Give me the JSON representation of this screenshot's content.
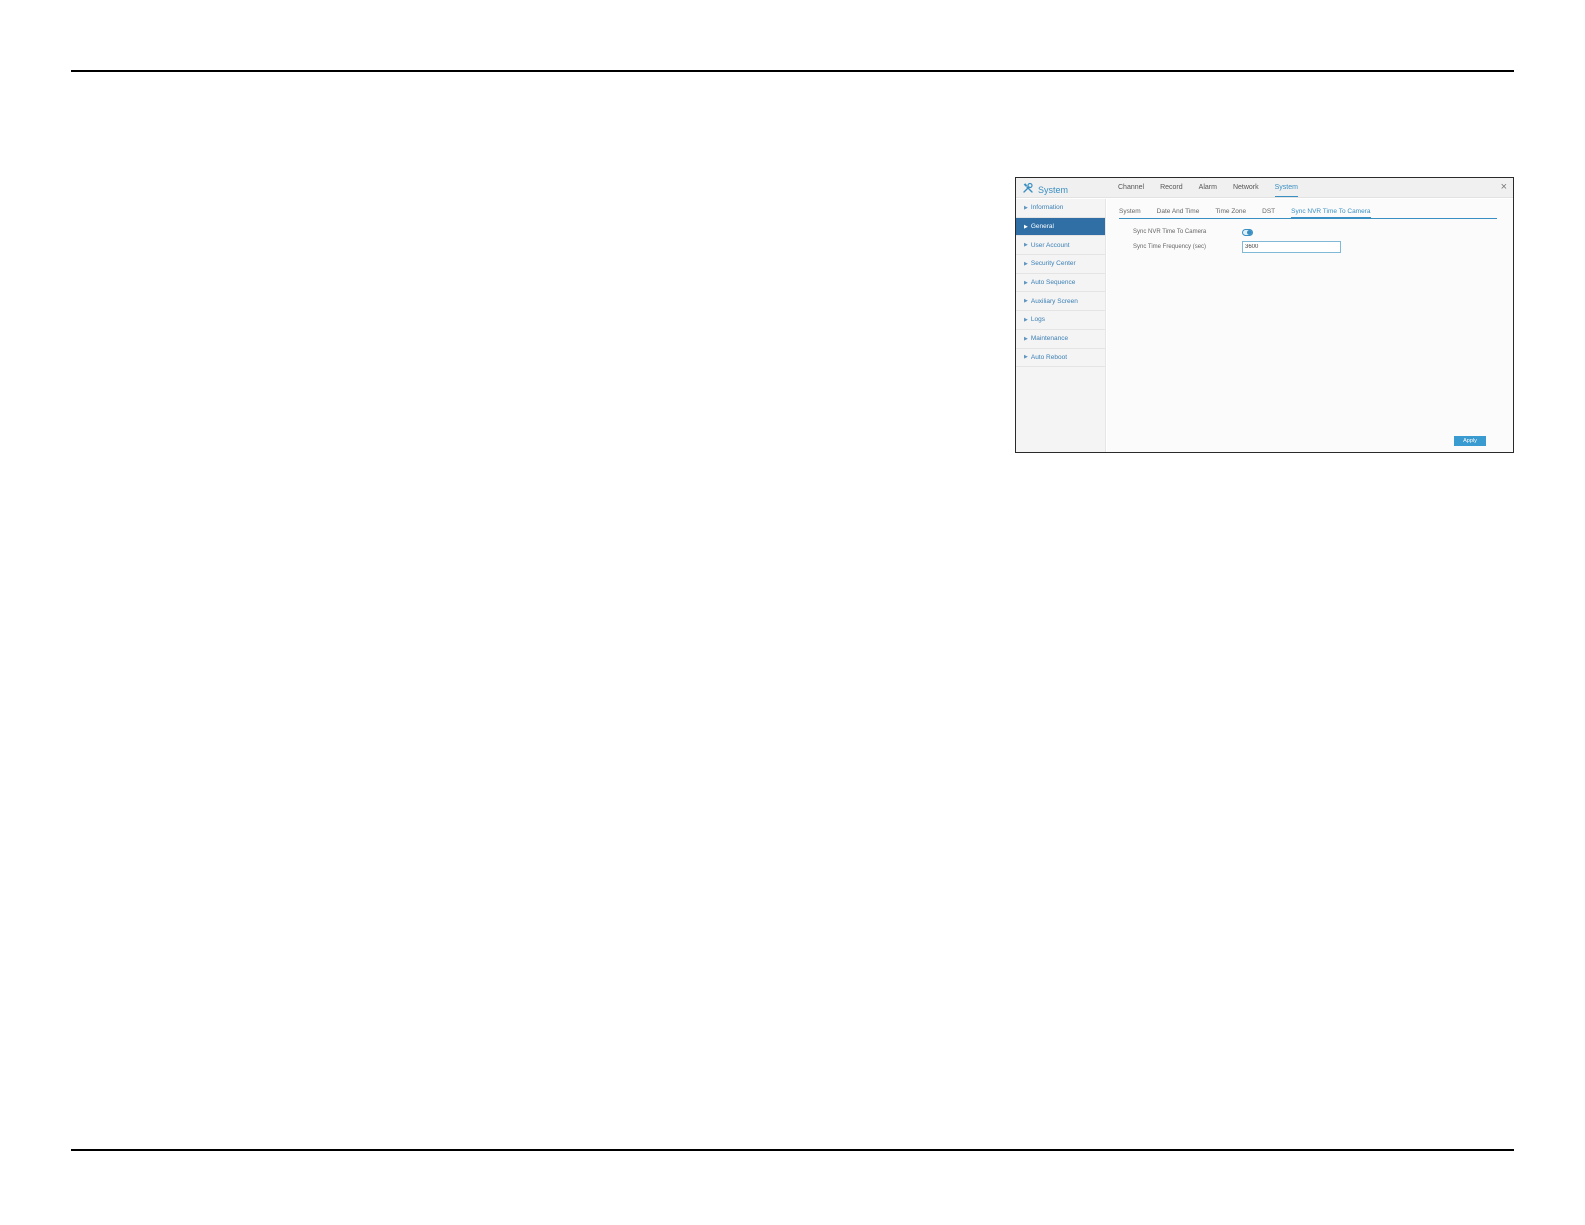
{
  "window": {
    "title": "System",
    "close_glyph": "×",
    "main_tabs": [
      {
        "label": "Channel"
      },
      {
        "label": "Record"
      },
      {
        "label": "Alarm"
      },
      {
        "label": "Network"
      },
      {
        "label": "System"
      }
    ],
    "active_main_tab": "System",
    "icon": "tools-icon"
  },
  "sidebar": {
    "items": [
      {
        "label": "Information"
      },
      {
        "label": "General"
      },
      {
        "label": "User Account"
      },
      {
        "label": "Security Center"
      },
      {
        "label": "Auto Sequence"
      },
      {
        "label": "Auxiliary Screen"
      },
      {
        "label": "Logs"
      },
      {
        "label": "Maintenance"
      },
      {
        "label": "Auto Reboot"
      }
    ],
    "active_item": "General",
    "arrow_glyph": "▶"
  },
  "content": {
    "sub_tabs": [
      {
        "label": "System"
      },
      {
        "label": "Date And Time"
      },
      {
        "label": "Time Zone"
      },
      {
        "label": "DST"
      },
      {
        "label": "Sync NVR Time To Camera"
      }
    ],
    "active_sub_tab": "Sync NVR Time To Camera",
    "sync_label": "Sync NVR Time To Camera",
    "sync_enabled": true,
    "frequency_label": "Sync Time Frequency (sec)",
    "frequency_value": "3600",
    "apply_label": "Apply"
  },
  "colors": {
    "accent": "#3a8fc2",
    "sidebar_active": "#2f6fa6",
    "apply_button": "#3a9bd0"
  }
}
